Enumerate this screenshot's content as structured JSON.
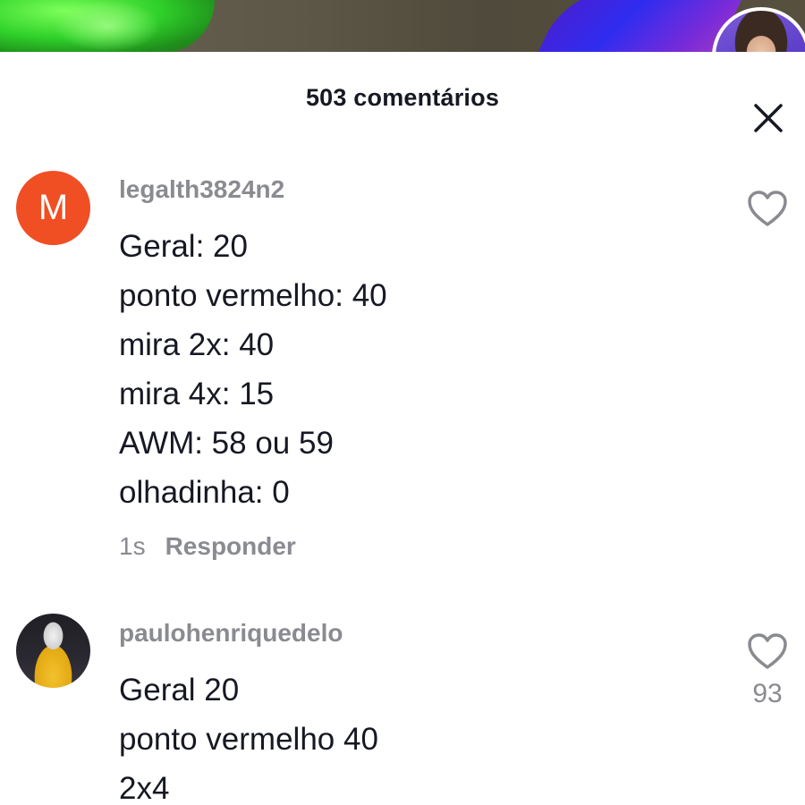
{
  "header": {
    "title": "503 comentários"
  },
  "comments": [
    {
      "avatar_letter": "M",
      "avatar_color": "#f04e23",
      "username": "legalth3824n2",
      "lines": [
        "Geral: 20",
        "ponto vermelho: 40",
        "mira 2x: 40",
        "mira 4x: 15",
        "AWM: 58 ou 59",
        "olhadinha: 0"
      ],
      "time": "1s",
      "reply_label": "Responder",
      "like_icon": "heart-outline-icon"
    },
    {
      "avatar_type": "photo",
      "username": "paulohenriquedelo",
      "lines": [
        "Geral 20",
        "ponto vermelho 40",
        "2x4"
      ],
      "like_icon": "heart-outline-icon",
      "likes": "93"
    }
  ],
  "icons": {
    "close": "close-icon"
  }
}
